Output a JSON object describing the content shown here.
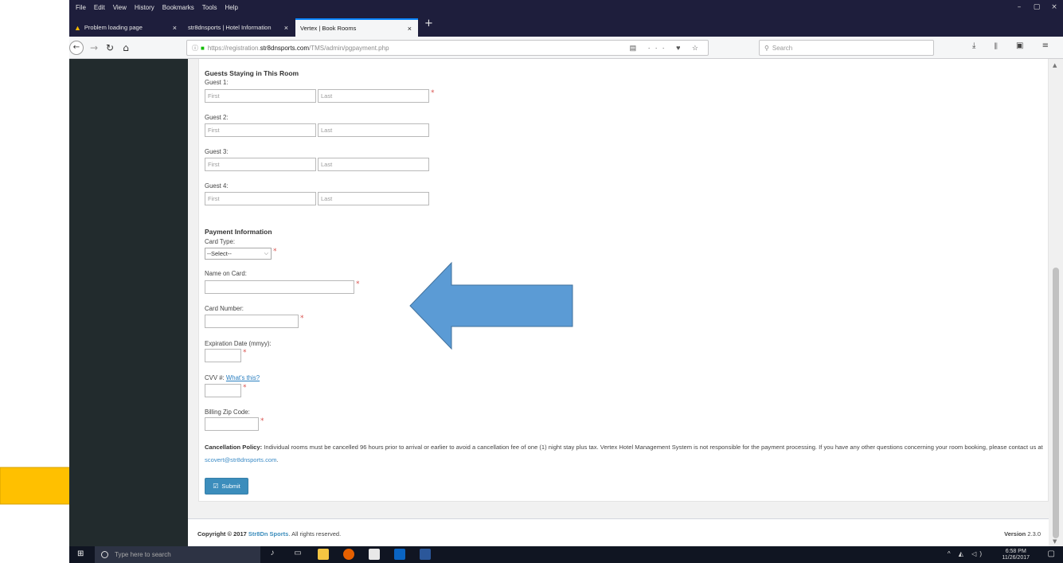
{
  "browser": {
    "menu": [
      "File",
      "Edit",
      "View",
      "History",
      "Bookmarks",
      "Tools",
      "Help"
    ],
    "window_controls": [
      "–",
      "▢",
      "×"
    ],
    "tabs": [
      {
        "title": "Problem loading page",
        "warning": true,
        "active": false
      },
      {
        "title": "str8dnsports | Hotel Information",
        "warning": false,
        "active": false
      },
      {
        "title": "Vertex | Book Rooms",
        "warning": false,
        "active": true
      }
    ],
    "new_tab": "+",
    "url_prefix": "https://registration.",
    "url_domain": "str8dnsports.com",
    "url_path": "/TMS/admin/pgpayment.php",
    "url_icons": "▤ ··· ♥ ☆",
    "search_placeholder": "Search",
    "toolbar_icons": "⤓ ⫴ ▣ ≡"
  },
  "form": {
    "guests_heading": "Guests Staying in This Room",
    "guests": [
      {
        "label": "Guest 1:",
        "first_placeholder": "First",
        "last_placeholder": "Last",
        "required": true
      },
      {
        "label": "Guest 2:",
        "first_placeholder": "First",
        "last_placeholder": "Last",
        "required": false
      },
      {
        "label": "Guest 3:",
        "first_placeholder": "First",
        "last_placeholder": "Last",
        "required": false
      },
      {
        "label": "Guest 4:",
        "first_placeholder": "First",
        "last_placeholder": "Last",
        "required": false
      }
    ],
    "payment_heading": "Payment Information",
    "card_type_label": "Card Type:",
    "card_type_value": "--Select--",
    "name_on_card_label": "Name on Card:",
    "card_number_label": "Card Number:",
    "expiration_label": "Expiration Date (mmyy):",
    "cvv_label": "CVV #:",
    "cvv_link": "What's this?",
    "zip_label": "Billing Zip Code:",
    "required_mark": "*",
    "policy_title": "Cancellation Policy:",
    "policy_text": " Individual rooms must be cancelled 96 hours prior to arrival or earlier to avoid a cancellation fee of one (1) night stay plus tax. Vertex Hotel Management System is not responsible for the payment processing. If you have any other questions concerning your room booking, please contact us at ",
    "policy_email": "scovert@str8dnsports.com",
    "policy_end": ".",
    "submit_label": "Submit"
  },
  "footer": {
    "copyright_prefix": "Copyright © 2017 ",
    "brand": "Str8Dn Sports",
    "copyright_suffix": ". All rights reserved.",
    "version_label": "Version",
    "version_number": " 2.3.0"
  },
  "taskbar": {
    "search_placeholder": "Type here to search",
    "time": "6:58 PM",
    "date": "11/26/2017",
    "tray_icons": "^ ◭ ◁)"
  },
  "annotations": {
    "blue_arrow_color": "#5b9bd5",
    "yellow_arrow_color": "#ffc000"
  }
}
